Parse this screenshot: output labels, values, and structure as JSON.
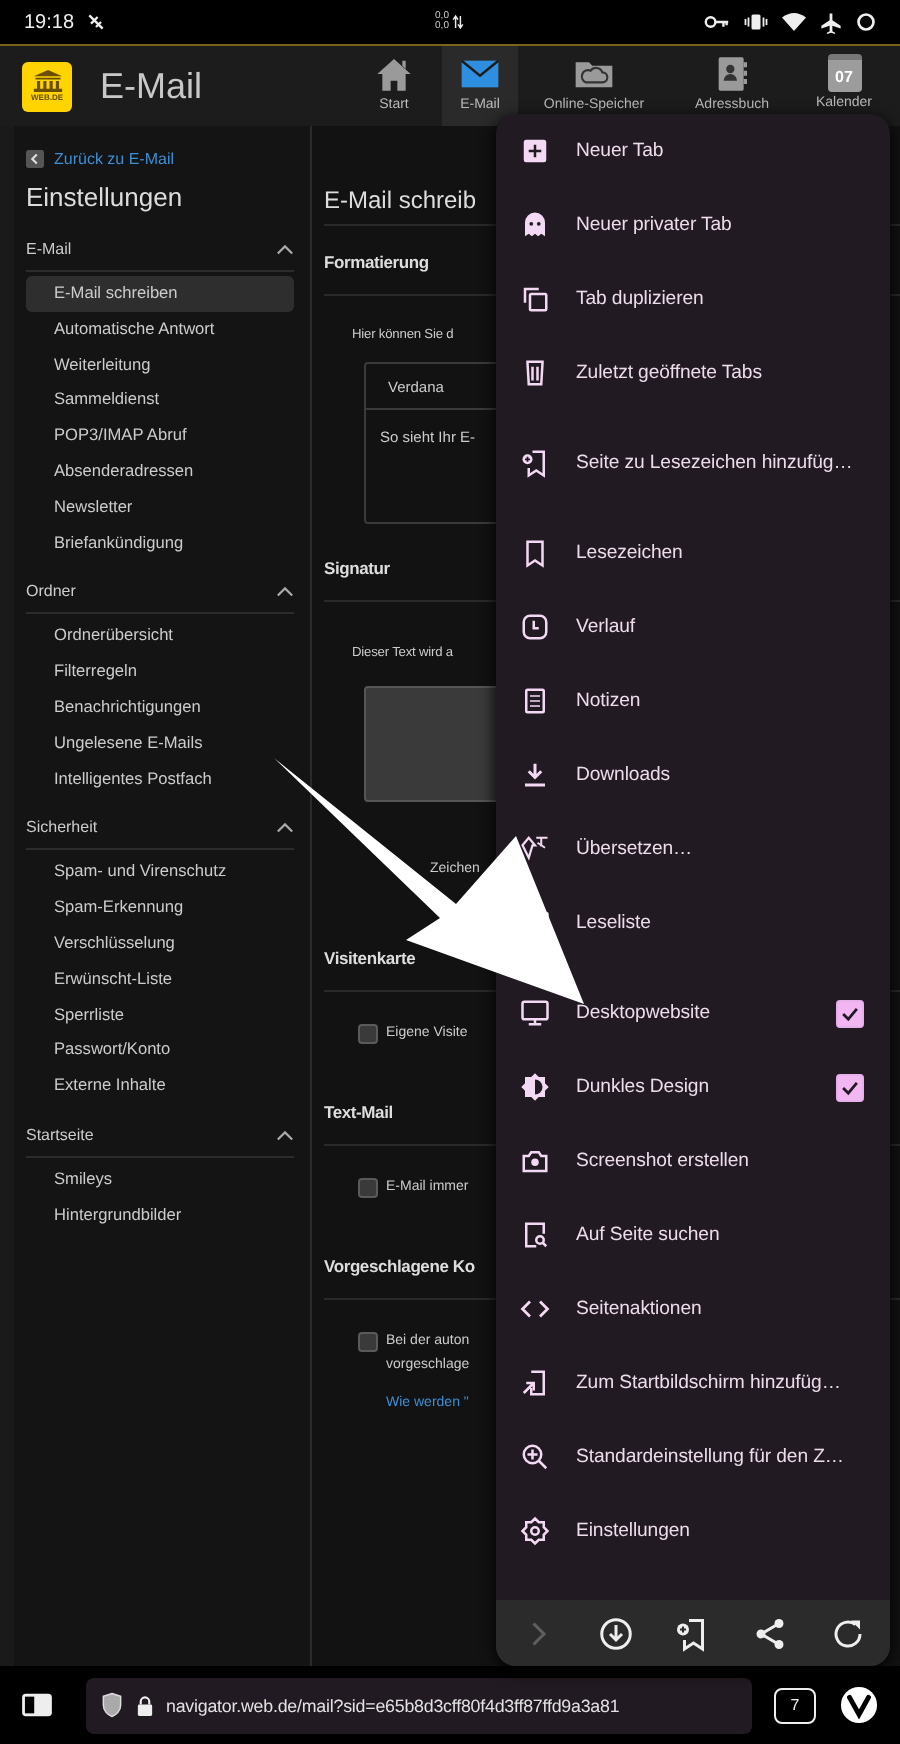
{
  "status_bar": {
    "time": "19:18",
    "data_rate": [
      "0,0",
      "0,0"
    ]
  },
  "app_header": {
    "logo_text": "WEB.DE",
    "title": "E-Mail",
    "nav": [
      {
        "label": "Start",
        "kind": "home",
        "selected": false
      },
      {
        "label": "E-Mail",
        "kind": "mail",
        "selected": true
      },
      {
        "label": "Online-Speicher",
        "kind": "cloud",
        "selected": false
      },
      {
        "label": "Adressbuch",
        "kind": "contacts",
        "selected": false
      },
      {
        "label": "Kalender",
        "kind": "calendar",
        "day": "07",
        "selected": false
      }
    ]
  },
  "sidebar": {
    "back_link": "Zurück zu E-Mail",
    "title": "Einstellungen",
    "groups": [
      {
        "title": "E-Mail",
        "expanded": true,
        "items": [
          {
            "label": "E-Mail schreiben",
            "selected": true
          },
          {
            "label": "Automatische Antwort",
            "selected": false
          },
          {
            "label": "Weiterleitung",
            "selected": false
          },
          {
            "label": "Sammeldienst",
            "selected": false
          },
          {
            "label": "POP3/IMAP Abruf",
            "selected": false
          },
          {
            "label": "Absenderadressen",
            "selected": false
          },
          {
            "label": "Newsletter",
            "selected": false
          },
          {
            "label": "Briefankündigung",
            "selected": false
          }
        ]
      },
      {
        "title": "Ordner",
        "expanded": true,
        "items": [
          {
            "label": "Ordnerübersicht",
            "selected": false
          },
          {
            "label": "Filterregeln",
            "selected": false
          },
          {
            "label": "Benachrichtigungen",
            "selected": false
          },
          {
            "label": "Ungelesene E-Mails",
            "selected": false
          },
          {
            "label": "Intelligentes Postfach",
            "selected": false
          }
        ]
      },
      {
        "title": "Sicherheit",
        "expanded": true,
        "items": [
          {
            "label": "Spam- und Virenschutz",
            "selected": false
          },
          {
            "label": "Spam-Erkennung",
            "selected": false
          },
          {
            "label": "Verschlüsselung",
            "selected": false
          },
          {
            "label": "Erwünscht-Liste",
            "selected": false
          },
          {
            "label": "Sperrliste",
            "selected": false
          },
          {
            "label": "Passwort/Konto",
            "selected": false
          },
          {
            "label": "Externe Inhalte",
            "selected": false
          }
        ]
      },
      {
        "title": "Startseite",
        "expanded": true,
        "items": [
          {
            "label": "Smileys",
            "selected": false
          },
          {
            "label": "Hintergrundbilder",
            "selected": false
          }
        ]
      }
    ]
  },
  "content": {
    "title": "E-Mail schreib",
    "sections": [
      {
        "heading": "Formatierung",
        "kind": "font",
        "description": "Hier können Sie d",
        "font": "Verdana",
        "preview": "So sieht Ihr E-"
      },
      {
        "heading": "Signatur",
        "kind": "signature",
        "description": "Dieser Text wird a",
        "counter": "Zeichen"
      },
      {
        "heading": "Visitenkarte",
        "kind": "checkbox",
        "options": [
          {
            "lines": [
              "Eigene Visite"
            ],
            "checked": false
          }
        ]
      },
      {
        "heading": "Text-Mail",
        "kind": "checkbox",
        "options": [
          {
            "lines": [
              "E-Mail immer"
            ],
            "checked": false
          }
        ]
      },
      {
        "heading": "Vorgeschlagene Ko",
        "kind": "checkbox",
        "options": [
          {
            "lines": [
              "Bei der auton",
              "vorgeschlage"
            ],
            "checked": false
          }
        ],
        "link": "Wie werden \""
      }
    ]
  },
  "menu": {
    "groups": [
      {
        "items": [
          {
            "label": "Neuer Tab"
          },
          {
            "label": "Neuer privater Tab"
          },
          {
            "label": "Tab duplizieren"
          },
          {
            "label": "Zuletzt geöffnete Tabs"
          }
        ]
      },
      {
        "items": [
          {
            "label": "Seite zu Lesezeichen hinzufüg…"
          }
        ]
      },
      {
        "items": [
          {
            "label": "Lesezeichen"
          },
          {
            "label": "Verlauf"
          },
          {
            "label": "Notizen"
          },
          {
            "label": "Downloads"
          },
          {
            "label": "Übersetzen…"
          },
          {
            "label": "Leseliste"
          }
        ]
      },
      {
        "items": [
          {
            "label": "Desktopwebsite",
            "checked": true
          },
          {
            "label": "Dunkles Design",
            "checked": true
          },
          {
            "label": "Screenshot erstellen"
          },
          {
            "label": "Auf Seite suchen"
          },
          {
            "label": "Seitenaktionen"
          },
          {
            "label": "Zum Startbildschirm hinzufüg…"
          },
          {
            "label": "Standardeinstellung für den Z…"
          },
          {
            "label": "Einstellungen"
          }
        ]
      }
    ],
    "toolbar": [
      {
        "disabled": true
      },
      {
        "disabled": false
      },
      {
        "disabled": false
      },
      {
        "disabled": false
      },
      {
        "disabled": false
      }
    ]
  },
  "browser_bar": {
    "url": "navigator.web.de/mail?sid=e65b8d3cff80f4d3ff87ffd9a3a81",
    "tab_count": "7"
  }
}
